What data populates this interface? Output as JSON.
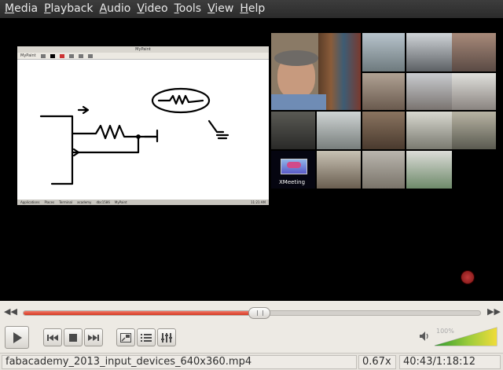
{
  "menu": {
    "items": [
      {
        "label": "Media",
        "accel": "M",
        "rest": "edia"
      },
      {
        "label": "Playback",
        "accel": "P",
        "rest": "layback"
      },
      {
        "label": "Audio",
        "accel": "A",
        "rest": "udio"
      },
      {
        "label": "Video",
        "accel": "V",
        "rest": "ideo"
      },
      {
        "label": "Tools",
        "accel": "T",
        "rest": "ools"
      },
      {
        "label": "View",
        "accel": "V",
        "rest": "iew"
      },
      {
        "label": "Help",
        "accel": "H",
        "rest": "elp"
      }
    ]
  },
  "video": {
    "paint_window": {
      "title": "MyPaint",
      "menu_text": "MyPaint",
      "taskbar": [
        "Applications",
        "Places",
        "Terminal",
        "academy",
        "dbc1586",
        "MyPaint",
        "11:21 AM"
      ]
    },
    "grid_label": "XMeeting"
  },
  "seek": {
    "position_fraction": 0.516
  },
  "buttons": {
    "play": "play-icon",
    "prev": "previous-icon",
    "stop": "stop-icon",
    "next": "next-icon",
    "fullscreen": "fullscreen-icon",
    "playlist": "playlist-icon",
    "extended": "extended-settings-icon"
  },
  "volume": {
    "label": "100%",
    "level_fraction": 1.0
  },
  "status": {
    "filename": "fabacademy_2013_input_devices_640x360.mp4",
    "speed": "0.67x",
    "time": "40:43/1:18:12"
  },
  "colors": {
    "seek_fill": "#d6371f",
    "menubar_bg": "#2b2b2b",
    "volume_high": "#e8d63a",
    "volume_low": "#3aa33a"
  }
}
